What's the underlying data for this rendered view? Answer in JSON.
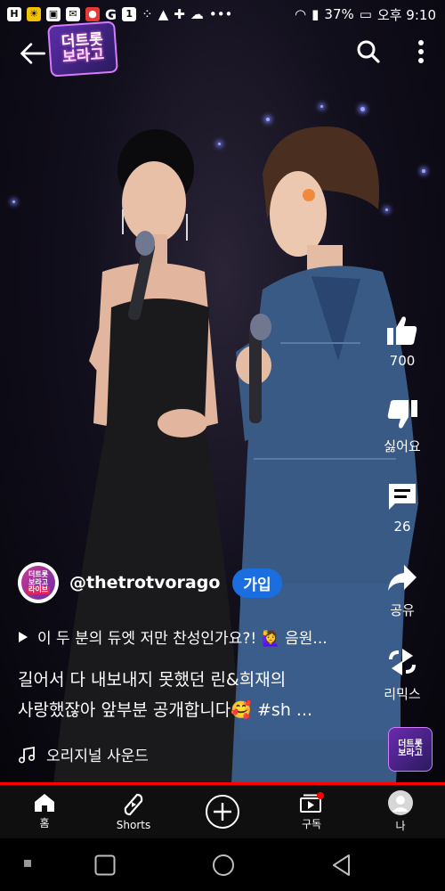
{
  "status_bar": {
    "left_icons": [
      "H",
      "sun-badge",
      "image",
      "mail",
      "crab",
      "G",
      "1",
      "dots",
      "warning",
      "plus",
      "cloud",
      "more"
    ],
    "battery": "37%",
    "time": "오후 9:10"
  },
  "channel_logo_top": {
    "line1": "더트롯",
    "line2": "보라고"
  },
  "actions": {
    "like_count": "700",
    "dislike_label": "싫어요",
    "comment_count": "26",
    "share_label": "공유",
    "remix_label": "리믹스"
  },
  "channel": {
    "avatar_line1": "더트롯",
    "avatar_line2": "보라고",
    "avatar_tag": "라이브",
    "handle": "@thetrotvorago",
    "subscribe_label": "가입"
  },
  "related_text": "이 두 분의 듀엣 저만 찬성인가요?! 🙋‍♀️ 음원...",
  "caption": {
    "line1": "길어서 다 내보내지 못했던 린&희재의",
    "line2": "사랑했잖아 앞부분 공개합니다🥰 #sh ..."
  },
  "sound_label": "오리지널 사운드",
  "progress": 1.0,
  "nav": [
    {
      "label": "홈",
      "icon": "home-icon"
    },
    {
      "label": "Shorts",
      "icon": "shorts-icon"
    },
    {
      "label": "",
      "icon": "create-icon"
    },
    {
      "label": "구독",
      "icon": "subscriptions-icon"
    },
    {
      "label": "나",
      "icon": "profile-icon"
    }
  ],
  "colors": {
    "accent": "#ff0000",
    "subscribe": "#1a6ee0",
    "brand_purple": "#6a2bb0"
  }
}
